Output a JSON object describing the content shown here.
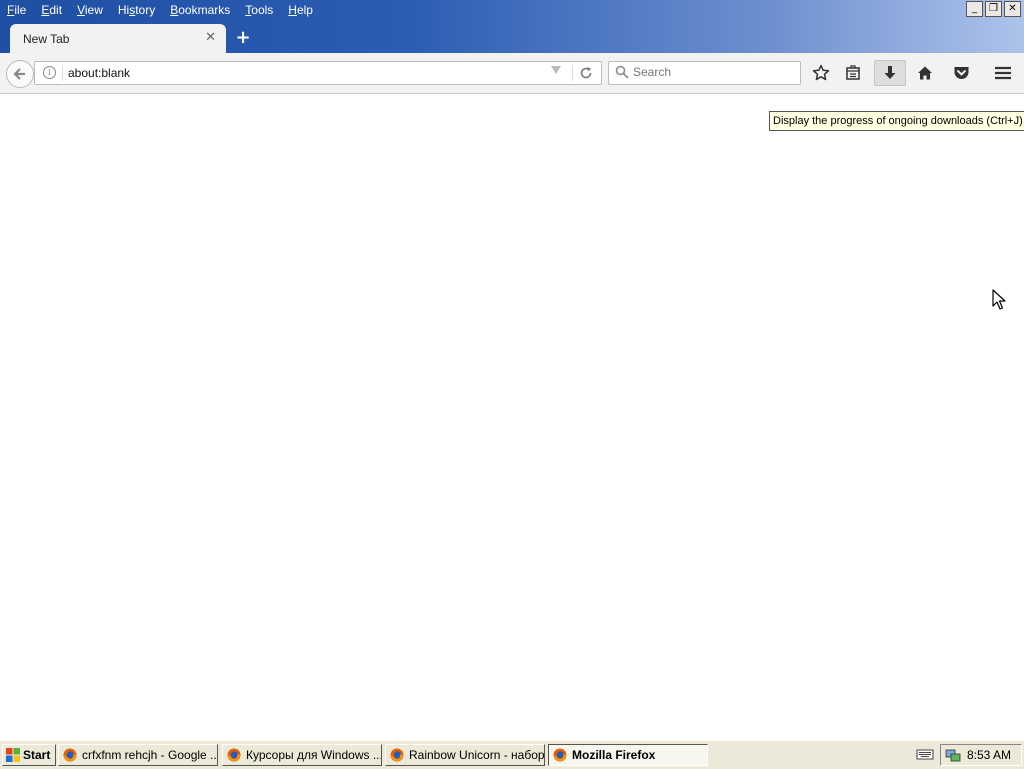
{
  "menubar": {
    "items": [
      {
        "pre": "",
        "ul": "F",
        "post": "ile"
      },
      {
        "pre": "",
        "ul": "E",
        "post": "dit"
      },
      {
        "pre": "",
        "ul": "V",
        "post": "iew"
      },
      {
        "pre": "Hi",
        "ul": "s",
        "post": "tory"
      },
      {
        "pre": "",
        "ul": "B",
        "post": "ookmarks"
      },
      {
        "pre": "",
        "ul": "T",
        "post": "ools"
      },
      {
        "pre": "",
        "ul": "H",
        "post": "elp"
      }
    ]
  },
  "tabs": {
    "active_title": "New Tab",
    "close_glyph": "✕",
    "new_tab_glyph": "+"
  },
  "window_controls": {
    "minimize": "_",
    "restore": "❐",
    "close": "✕"
  },
  "navbar": {
    "url": "about:blank",
    "search_placeholder": "Search",
    "icons": [
      "back-arrow-icon",
      "info-icon",
      "url-dropdown-icon",
      "reload-icon",
      "search-icon",
      "bookmark-star-icon",
      "library-icon",
      "downloads-icon",
      "home-icon",
      "pocket-icon",
      "hamburger-menu-icon"
    ]
  },
  "tooltip": {
    "text": "Display the progress of ongoing downloads (Ctrl+J)"
  },
  "taskbar": {
    "start_label": "Start",
    "tasks": [
      {
        "label": "crfxfnm rehcjh - Google ...",
        "active": false
      },
      {
        "label": "Курсоры для Windows ...",
        "active": false
      },
      {
        "label": "Rainbow Unicorn - набор...",
        "active": false
      },
      {
        "label": "Mozilla Firefox",
        "active": true
      }
    ],
    "clock": "8:53 AM"
  },
  "colors": {
    "titlebar_start": "#1f4fa3",
    "titlebar_end": "#aec3ea",
    "toolbar": "#f2f2f2",
    "tooltip_bg": "#ffffe1",
    "taskbar": "#ece9d8"
  }
}
